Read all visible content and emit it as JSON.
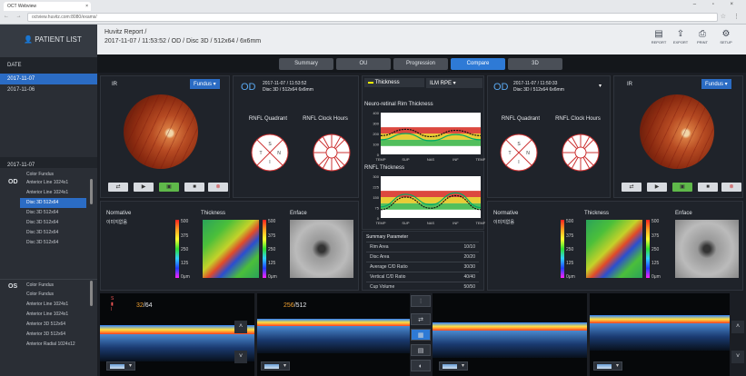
{
  "browser": {
    "tab_title": "OCT Webview",
    "url": "octview.huvitz.com:8080/exams/",
    "window_label": " "
  },
  "sidebar": {
    "patient_list": "PATIENT LIST",
    "date_header": "DATE",
    "dates": [
      "2017-11-07",
      "2017-11-06"
    ],
    "selected_date_header": "2017-11-07",
    "od_label": "OD",
    "od_scans": [
      "Color Fundus",
      "Anterior Line 1024x1",
      "Anterior Line 1024x1",
      "Disc 3D 512x64",
      "Disc 3D 512x64",
      "Disc 3D 512x64",
      "Disc 3D 512x64",
      "Disc 3D 512x64"
    ],
    "os_label": "OS",
    "os_scans": [
      "Color Fundus",
      "Color Fundus",
      "Anterior Line 1024x1",
      "Anterior Line 1024x1",
      "Anterior 3D 512x64",
      "Anterior 3D 512x64",
      "Anterior Radial 1024x12"
    ]
  },
  "header": {
    "title": "Huvitz Report /",
    "subtitle": "2017-11-07 / 11:53:52 / OD / Disc 3D / 512x64 / 6x6mm",
    "tools": [
      "REPORT",
      "EXPORT",
      "PRINT",
      "SETUP"
    ]
  },
  "tabs": [
    "Summary",
    "OU",
    "Progression",
    "Compare",
    "3D"
  ],
  "left": {
    "ir_label": "IR",
    "fundus_select": "Fundus",
    "od_title": "OD",
    "info_line1": "2017-11-07 / 11:53:52",
    "info_line2": "Disc 3D / 512x64 6x6mm",
    "rnfl_quadrant": "RNFL Quadrant",
    "rnfl_clock": "RNFL Clock Hours",
    "normative": "Normative",
    "normative_sub": "이미지없음",
    "thickness": "Thickness",
    "enface": "Enface",
    "scan_counter_num": "32",
    "scan_counter_den": "/64",
    "bscan_counter_num": "256",
    "bscan_counter_den": "/512"
  },
  "center": {
    "thickness_select": "Thickness",
    "rpe_select": "ILM RPE",
    "nr_title": "Neuro-retinal Rim Thickness",
    "rnfl_title": "RNFL Thickness",
    "x_ticks": [
      "TEMP",
      "SUP",
      "NAS",
      "INF",
      "TEMP"
    ],
    "summary_title": "Summary Parameter",
    "params": [
      {
        "k": "Rim Area",
        "v": "10/10"
      },
      {
        "k": "Disc Area",
        "v": "20/20"
      },
      {
        "k": "Average C/D Ratio",
        "v": "30/30"
      },
      {
        "k": "Vertical C/D Ratio",
        "v": "40/40"
      },
      {
        "k": "Cup Volume",
        "v": "50/50"
      }
    ]
  },
  "right": {
    "od_title": "OD",
    "info_line1": "2017-11-07 / 11:50:33",
    "info_line2": "Disc 3D / 512x64 6x6mm",
    "ir_label": "IR",
    "fundus_select": "Fundus",
    "rnfl_quadrant": "RNFL Quadrant",
    "rnfl_clock": "RNFL Clock Hours",
    "normative": "Normative",
    "normative_sub": "이미지없음",
    "thickness": "Thickness",
    "enface": "Enface"
  },
  "colorbar_ticks": [
    "500",
    "375",
    "250",
    "125",
    "0μm"
  ],
  "chart_data": [
    {
      "type": "area",
      "title": "Neuro-retinal Rim Thickness",
      "categories": [
        "TEMP",
        "SUP",
        "NAS",
        "INF",
        "TEMP"
      ],
      "ylim": [
        0,
        400
      ],
      "yticks": [
        "400",
        "300",
        "200",
        "100",
        "0"
      ],
      "series": [
        {
          "values": [
            180,
            240,
            170,
            230,
            180
          ]
        },
        {
          "values": [
            140,
            200,
            130,
            190,
            140
          ]
        }
      ]
    },
    {
      "type": "area",
      "title": "RNFL Thickness",
      "categories": [
        "TEMP",
        "SUP",
        "NAS",
        "INF",
        "TEMP"
      ],
      "ylim": [
        0,
        300
      ],
      "yticks": [
        "300",
        "225",
        "150",
        "75",
        "0"
      ],
      "series": [
        {
          "values": [
            60,
            150,
            70,
            160,
            60
          ]
        },
        {
          "values": [
            80,
            170,
            95,
            180,
            75
          ]
        }
      ]
    }
  ],
  "colors": {
    "accent": "#2e7ad6",
    "od": "#5aa8f0",
    "counter": "#f0a030"
  }
}
